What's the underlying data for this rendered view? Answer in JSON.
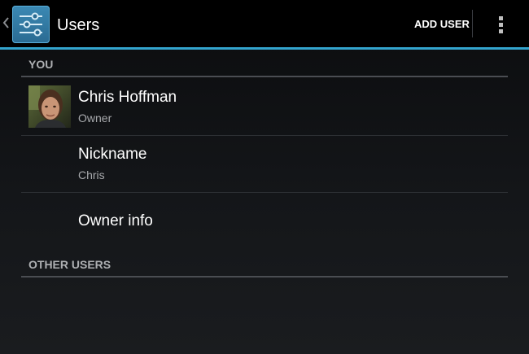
{
  "action_bar": {
    "title": "Users",
    "add_user_label": "ADD USER",
    "up_icon": "chevron-left-icon",
    "app_icon": "settings-sliders-icon",
    "overflow_icon": "overflow-menu-icon",
    "accent_color": "#33a4cd"
  },
  "sections": {
    "you": {
      "header": "YOU",
      "items": [
        {
          "primary": "Chris Hoffman",
          "secondary": "Owner",
          "icon": "user-avatar"
        },
        {
          "primary": "Nickname",
          "secondary": "Chris"
        },
        {
          "primary": "Owner info"
        }
      ]
    },
    "other_users": {
      "header": "OTHER USERS"
    }
  }
}
